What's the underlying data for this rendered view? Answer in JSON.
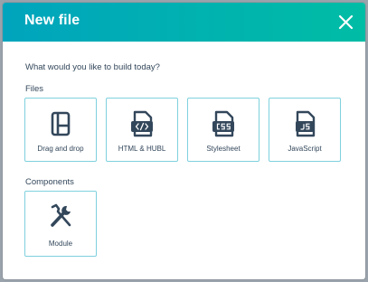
{
  "dialog": {
    "title": "New file",
    "prompt": "What would you like to build today?"
  },
  "files_section": {
    "title": "Files",
    "items": [
      {
        "label": "Drag and drop",
        "icon": "drag-drop-layout-icon"
      },
      {
        "label": "HTML & HUBL",
        "icon": "html-file-icon"
      },
      {
        "label": "Stylesheet",
        "icon": "css-file-icon"
      },
      {
        "label": "JavaScript",
        "icon": "js-file-icon"
      }
    ]
  },
  "components_section": {
    "title": "Components",
    "items": [
      {
        "label": "Module",
        "icon": "tools-icon"
      }
    ]
  },
  "colors": {
    "header_start": "#00a4bd",
    "header_end": "#00bda5",
    "card_border": "#7fd1de",
    "icon": "#33475b",
    "text": "#33475b"
  }
}
